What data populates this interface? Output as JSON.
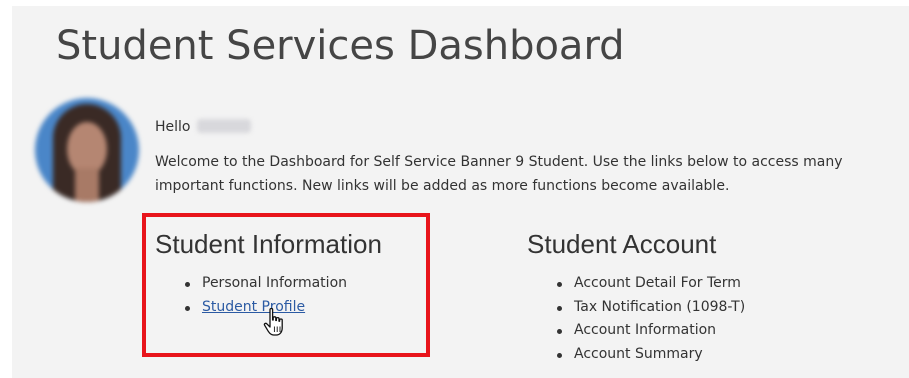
{
  "page": {
    "title": "Student Services Dashboard"
  },
  "user": {
    "greeting": "Hello"
  },
  "welcome_text": "Welcome to the Dashboard for Self Service Banner 9 Student. Use the links below to access many important functions. New links will be added as more functions become available.",
  "student_information": {
    "heading": "Student Information",
    "links": [
      {
        "label": "Personal Information"
      },
      {
        "label": "Student Profile"
      }
    ]
  },
  "student_account": {
    "heading": "Student Account",
    "links": [
      {
        "label": "Account Detail For Term"
      },
      {
        "label": "Tax Notification (1098-T)"
      },
      {
        "label": "Account Information"
      },
      {
        "label": "Account Summary"
      }
    ]
  },
  "icons": {
    "cursor": "hand-pointer-icon",
    "avatar": "user-avatar"
  },
  "colors": {
    "panel_background": "#f3f3f3",
    "link": "#2b5aa3",
    "highlight": "#e8141b",
    "text": "#333333",
    "avatar_background": "#4a86c8"
  }
}
